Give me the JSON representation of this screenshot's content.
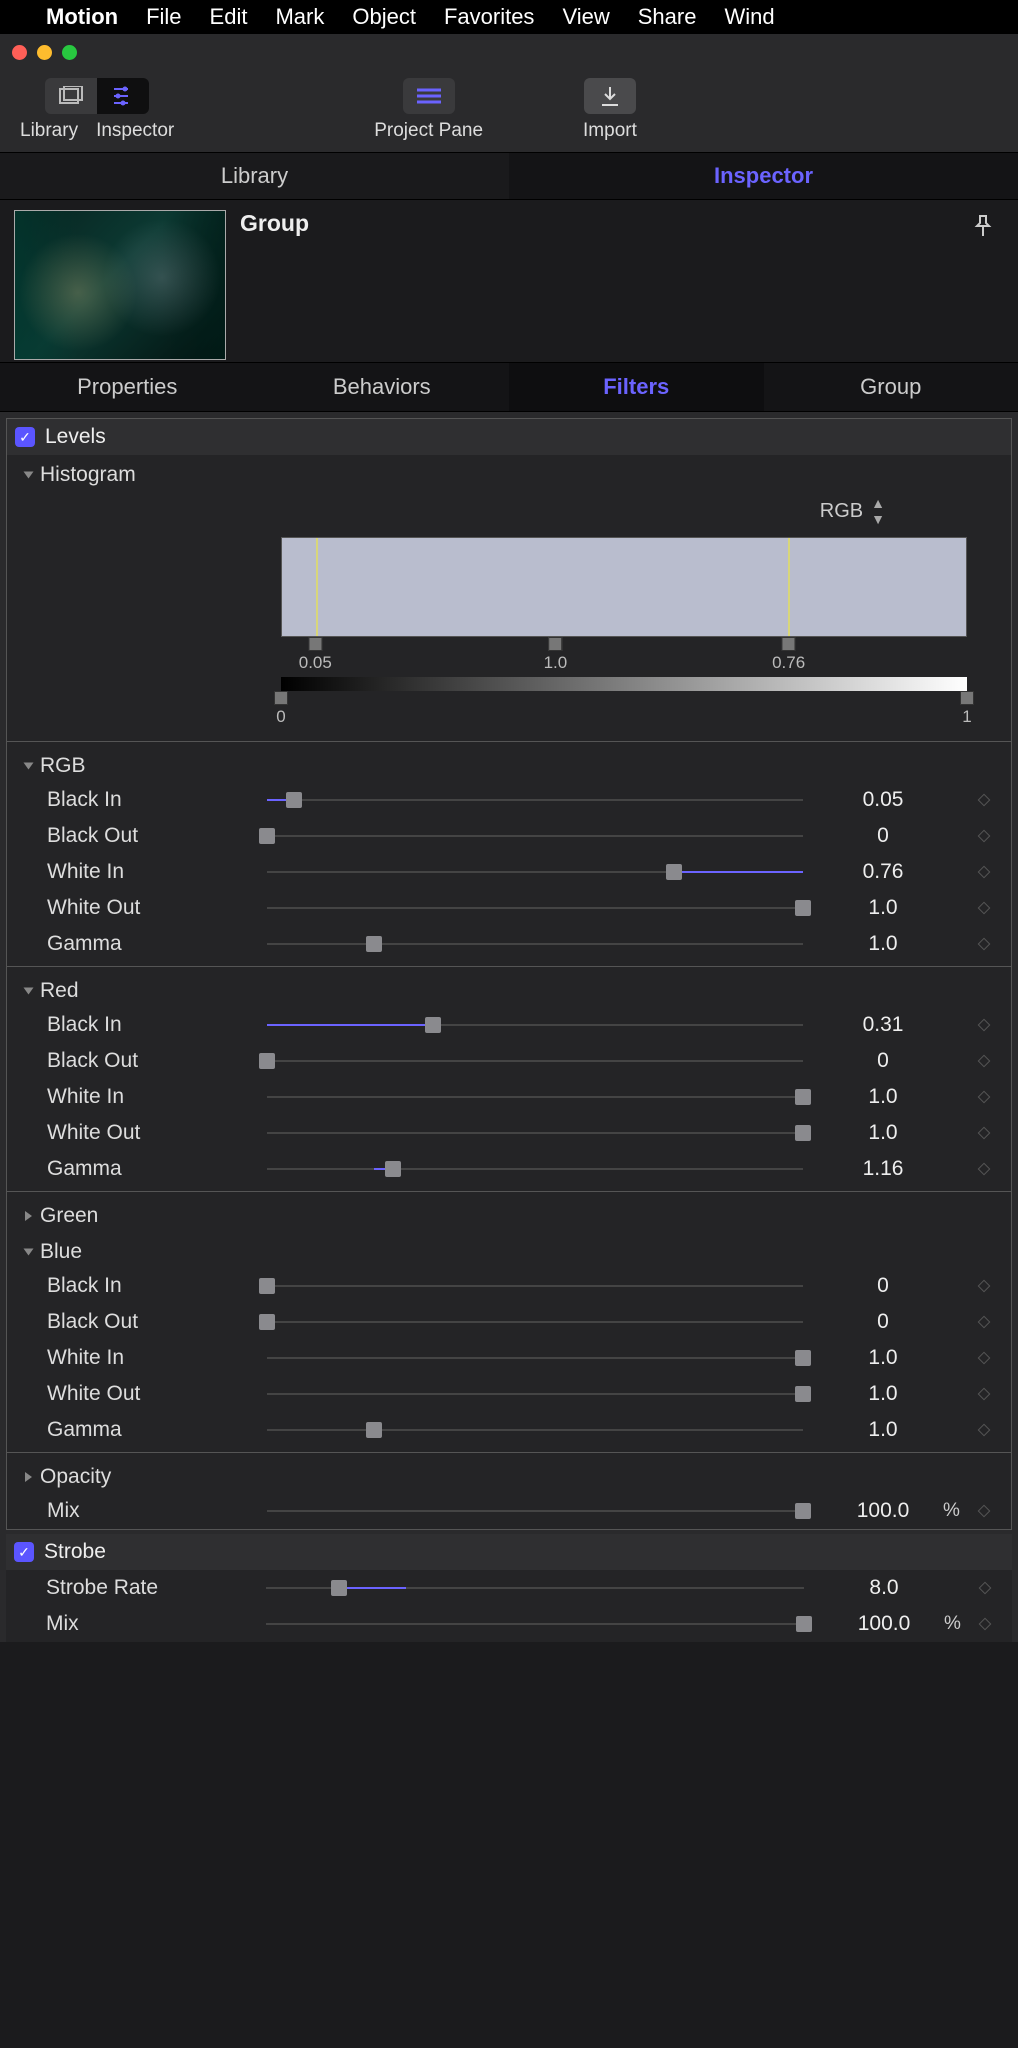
{
  "menubar": {
    "app": "Motion",
    "items": [
      "File",
      "Edit",
      "Mark",
      "Object",
      "Favorites",
      "View",
      "Share",
      "Wind"
    ]
  },
  "toolbar": {
    "library_label": "Library",
    "inspector_label": "Inspector",
    "project_pane_label": "Project Pane",
    "import_label": "Import"
  },
  "panel_tabs": {
    "library": "Library",
    "inspector": "Inspector"
  },
  "preview": {
    "title": "Group"
  },
  "sub_tabs": {
    "properties": "Properties",
    "behaviors": "Behaviors",
    "filters": "Filters",
    "group": "Group"
  },
  "filters": {
    "levels": {
      "name": "Levels",
      "histogram": {
        "label": "Histogram",
        "channel": "RGB",
        "in_black": {
          "pos": 0.05,
          "text": "0.05"
        },
        "in_mid": {
          "pos": 0.4,
          "text": "1.0"
        },
        "in_white": {
          "pos": 0.74,
          "text": "0.76"
        },
        "out_black": {
          "pos": 0.0,
          "text": "0"
        },
        "out_white": {
          "pos": 1.0,
          "text": "1"
        }
      },
      "groups": [
        {
          "name": "RGB",
          "open": true,
          "params": [
            {
              "label": "Black In",
              "value": "0.05",
              "fill_from": 0,
              "fill_to": 0.05,
              "thumb": 0.05
            },
            {
              "label": "Black Out",
              "value": "0",
              "thumb": 0.0
            },
            {
              "label": "White In",
              "value": "0.76",
              "fill_from": 0.76,
              "fill_to": 1.0,
              "thumb": 0.76
            },
            {
              "label": "White Out",
              "value": "1.0",
              "thumb": 1.0
            },
            {
              "label": "Gamma",
              "value": "1.0",
              "thumb": 0.2
            }
          ]
        },
        {
          "name": "Red",
          "open": true,
          "params": [
            {
              "label": "Black In",
              "value": "0.31",
              "fill_from": 0,
              "fill_to": 0.31,
              "thumb": 0.31
            },
            {
              "label": "Black Out",
              "value": "0",
              "thumb": 0.0
            },
            {
              "label": "White In",
              "value": "1.0",
              "thumb": 1.0
            },
            {
              "label": "White Out",
              "value": "1.0",
              "thumb": 1.0
            },
            {
              "label": "Gamma",
              "value": "1.16",
              "fill_from": 0.2,
              "fill_to": 0.235,
              "thumb": 0.235
            }
          ]
        },
        {
          "name": "Green",
          "open": false
        },
        {
          "name": "Blue",
          "open": true,
          "params": [
            {
              "label": "Black In",
              "value": "0",
              "thumb": 0.0
            },
            {
              "label": "Black Out",
              "value": "0",
              "thumb": 0.0
            },
            {
              "label": "White In",
              "value": "1.0",
              "thumb": 1.0
            },
            {
              "label": "White Out",
              "value": "1.0",
              "thumb": 1.0
            },
            {
              "label": "Gamma",
              "value": "1.0",
              "thumb": 0.2
            }
          ]
        },
        {
          "name": "Opacity",
          "open": false
        }
      ],
      "mix": {
        "label": "Mix",
        "value": "100.0",
        "unit": "%",
        "thumb": 1.0
      }
    },
    "strobe": {
      "name": "Strobe",
      "params": [
        {
          "label": "Strobe Rate",
          "value": "8.0",
          "fill_from": 0.135,
          "fill_to": 0.26,
          "thumb": 0.135
        },
        {
          "label": "Mix",
          "value": "100.0",
          "unit": "%",
          "thumb": 1.0
        }
      ]
    }
  }
}
